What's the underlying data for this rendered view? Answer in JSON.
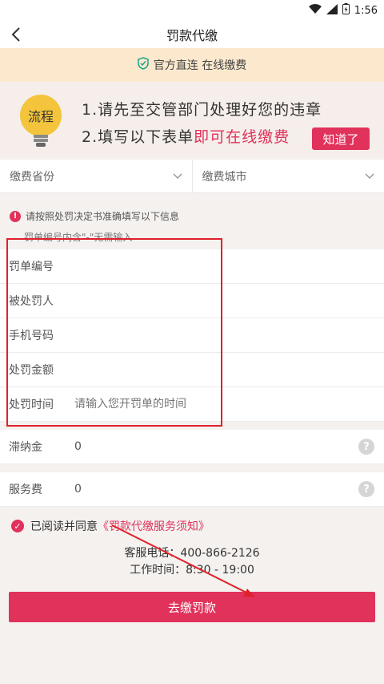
{
  "status": {
    "time": "1:56"
  },
  "header": {
    "title": "罚款代缴"
  },
  "official": {
    "text": "官方直连 在线缴费"
  },
  "process": {
    "badge": "流程",
    "step1": "1.请先至交管部门处理好您的违章",
    "step2_prefix": "2.填写以下表单",
    "step2_highlight": "即可在线缴费",
    "know_button": "知道了"
  },
  "selects": {
    "province": "缴费省份",
    "city": "缴费城市"
  },
  "notice": {
    "line1": "请按照处罚决定书准确填写以下信息",
    "line2": "罚单编号内含\"-\"无需输入"
  },
  "form": {
    "ticket_no": "罚单编号",
    "person": "被处罚人",
    "phone": "手机号码",
    "amount": "处罚金额",
    "time_label": "处罚时间",
    "time_placeholder": "请输入您开罚单的时间"
  },
  "late_fee": {
    "label": "滞纳金",
    "value": "0"
  },
  "service_fee": {
    "label": "服务费",
    "value": "0"
  },
  "agree": {
    "text": "已阅读并同意",
    "link": "《罚款代缴服务须知》"
  },
  "contact": {
    "phone": "客服电话：400-866-2126",
    "hours": "工作时间：8:30 - 19:00"
  },
  "submit": {
    "label": "去缴罚款"
  },
  "colors": {
    "accent": "#e0325b",
    "banner": "#fbe8cd",
    "annotation": "#e0202a"
  }
}
